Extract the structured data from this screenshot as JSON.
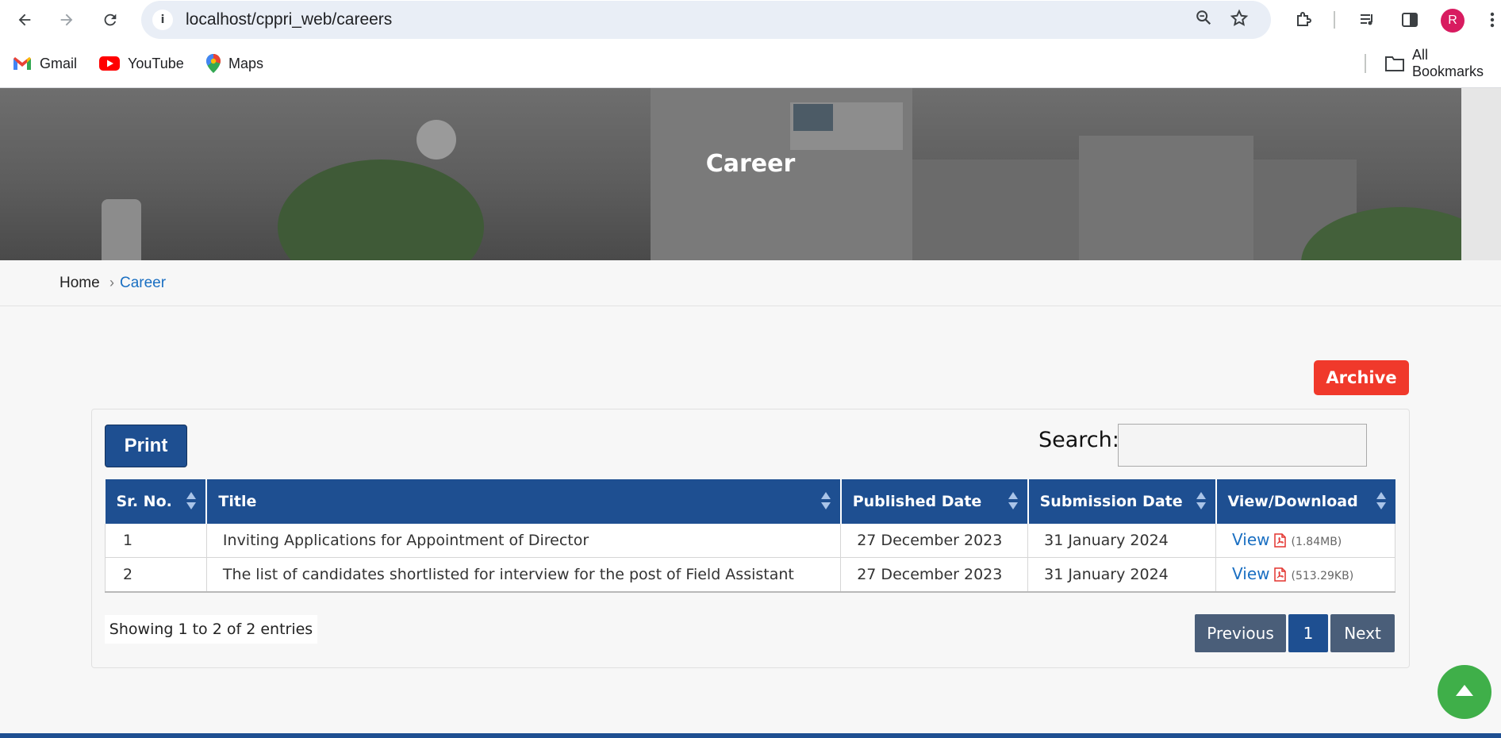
{
  "browser": {
    "url": "localhost/cppri_web/careers",
    "profile_initial": "R",
    "bookmarks": [
      {
        "label": "Gmail",
        "icon": "gmail-icon"
      },
      {
        "label": "YouTube",
        "icon": "youtube-icon"
      },
      {
        "label": "Maps",
        "icon": "maps-icon"
      }
    ],
    "all_bookmarks_label": "All Bookmarks"
  },
  "hero": {
    "title": "Career"
  },
  "breadcrumb": {
    "home": "Home",
    "separator": "›",
    "current": "Career"
  },
  "actions": {
    "archive_label": "Archive",
    "print_label": "Print",
    "search_label": "Search:",
    "search_value": ""
  },
  "table": {
    "columns": [
      "Sr. No.",
      "Title",
      "Published Date",
      "Submission Date",
      "View/Download"
    ],
    "rows": [
      {
        "sr": "1",
        "title": "Inviting Applications for Appointment of Director",
        "published": "27 December 2023",
        "submission": "31 January 2024",
        "view": "View",
        "size": "(1.84MB)"
      },
      {
        "sr": "2",
        "title": "The list of candidates shortlisted for interview for the post of Field Assistant",
        "published": "27 December 2023",
        "submission": "31 January 2024",
        "view": "View",
        "size": "(513.29KB)"
      }
    ]
  },
  "footer_info": {
    "showing": "Showing 1 to 2 of 2 entries"
  },
  "pagination": {
    "previous": "Previous",
    "current": "1",
    "next": "Next"
  },
  "colors": {
    "primary": "#1e4f91",
    "archive": "#f0392b",
    "link": "#1a6fc2",
    "to_top": "#3faf49"
  }
}
